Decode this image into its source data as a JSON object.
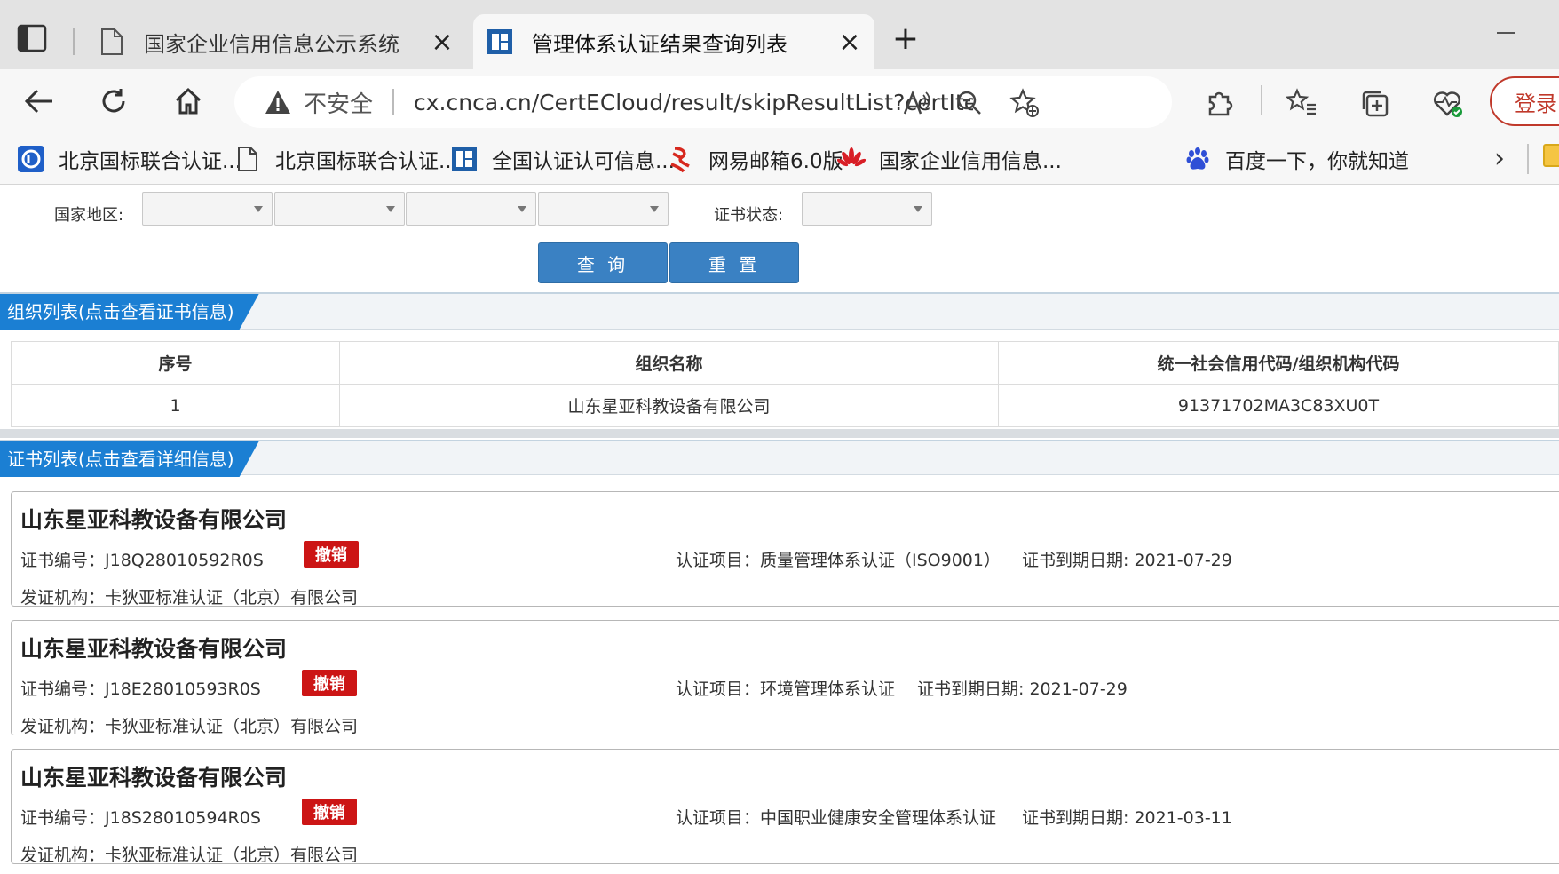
{
  "browser": {
    "tabs": [
      {
        "label": "国家企业信用信息公示系统",
        "icon": "document-icon",
        "active": false
      },
      {
        "label": "管理体系认证结果查询列表",
        "icon": "site-favicon-icon",
        "active": true
      }
    ],
    "security_label": "不安全",
    "url": "cx.cnca.cn/CertECloud/result/skipResultList?certItem...",
    "login_label": "登录",
    "bookmarks": [
      {
        "label": "北京国标联合认证...",
        "icon": "blue-logo-icon"
      },
      {
        "label": "北京国标联合认证...",
        "icon": "document-icon"
      },
      {
        "label": "全国认证认可信息...",
        "icon": "site-favicon-icon"
      },
      {
        "label": "网易邮箱6.0版",
        "icon": "netease-mail-icon"
      },
      {
        "label": "国家企业信用信息...",
        "icon": "huawei-flower-icon"
      },
      {
        "label": "百度一下，你就知道",
        "icon": "baidu-paw-icon"
      }
    ]
  },
  "filters": {
    "region_label": "国家地区:",
    "status_label": "证书状态:",
    "query_button": "查 询",
    "reset_button": "重 置"
  },
  "org_section": {
    "title": "组织列表(点击查看证书信息)",
    "columns": [
      "序号",
      "组织名称",
      "统一社会信用代码/组织机构代码"
    ],
    "rows": [
      {
        "index": "1",
        "name": "山东星亚科教设备有限公司",
        "code": "91371702MA3C83XU0T"
      }
    ]
  },
  "cert_section": {
    "title": "证书列表(点击查看详细信息)",
    "items": [
      {
        "company": "山东星亚科教设备有限公司",
        "cert_no": "证书编号：J18Q28010592R0S",
        "status": "撤销",
        "project": "认证项目：质量管理体系认证（ISO9001）",
        "expiry": "证书到期日期: 2021-07-29",
        "issuer": "发证机构：卡狄亚标准认证（北京）有限公司"
      },
      {
        "company": "山东星亚科教设备有限公司",
        "cert_no": "证书编号：J18E28010593R0S",
        "status": "撤销",
        "project": "认证项目：环境管理体系认证",
        "expiry": "证书到期日期: 2021-07-29",
        "issuer": "发证机构：卡狄亚标准认证（北京）有限公司"
      },
      {
        "company": "山东星亚科教设备有限公司",
        "cert_no": "证书编号：J18S28010594R0S",
        "status": "撤销",
        "project": "认证项目：中国职业健康安全管理体系认证",
        "expiry": "证书到期日期: 2021-03-11",
        "issuer": "发证机构：卡狄亚标准认证（北京）有限公司"
      }
    ]
  },
  "colors": {
    "accent": "#1b7fd3",
    "button": "#3a81c3",
    "revoked": "#cc1515",
    "login": "#c0392b"
  }
}
